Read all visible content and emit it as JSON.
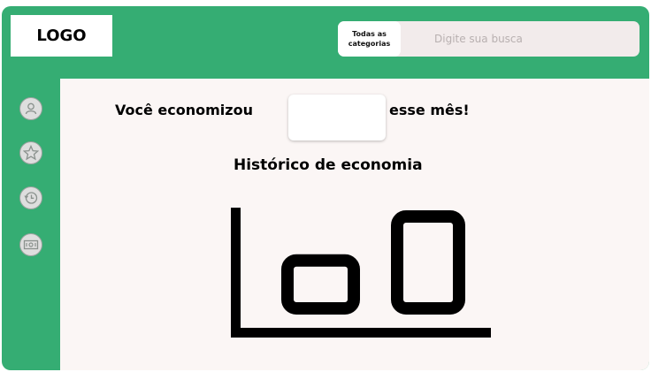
{
  "header": {
    "logo": "LOGO",
    "search": {
      "category_label": "Todas as categorias",
      "placeholder": "Digite sua busca",
      "value": ""
    }
  },
  "sidebar": {
    "items": [
      {
        "icon": "user-icon"
      },
      {
        "icon": "star-icon"
      },
      {
        "icon": "history-icon"
      },
      {
        "icon": "money-icon"
      }
    ]
  },
  "main": {
    "savings_prefix": "Você economizou",
    "savings_value": "",
    "savings_suffix": "esse mês!",
    "history_title": "Histórico de economia"
  },
  "colors": {
    "accent": "#35ad73",
    "content_bg": "#fbf6f5",
    "search_bg": "#f2ebeb"
  },
  "chart_data": {
    "type": "bar",
    "categories": [
      "",
      ""
    ],
    "values": [
      2,
      3.5
    ],
    "ylim": [
      0,
      3.5
    ],
    "title": "",
    "xlabel": "",
    "ylabel": ""
  }
}
